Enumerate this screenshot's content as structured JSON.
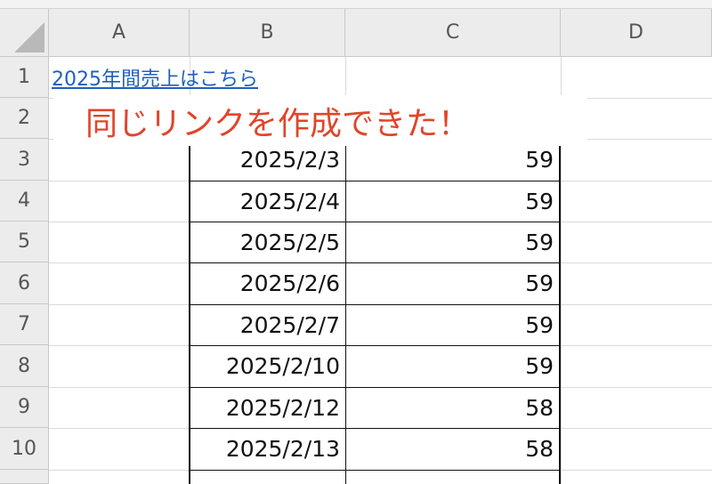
{
  "columns": [
    "A",
    "B",
    "C",
    "D"
  ],
  "row_numbers": [
    "1",
    "2",
    "3",
    "4",
    "5",
    "6",
    "7",
    "8",
    "9",
    "10"
  ],
  "a1_link": "2025年間売上はこちら",
  "banner_text": "同じリンクを作成できた！",
  "rows": [
    {
      "date": "2025/2/3",
      "value": "59"
    },
    {
      "date": "2025/2/4",
      "value": "59"
    },
    {
      "date": "2025/2/5",
      "value": "59"
    },
    {
      "date": "2025/2/6",
      "value": "59"
    },
    {
      "date": "2025/2/7",
      "value": "59"
    },
    {
      "date": "2025/2/10",
      "value": "59"
    },
    {
      "date": "2025/2/12",
      "value": "58"
    },
    {
      "date": "2025/2/13",
      "value": "58"
    }
  ],
  "colors": {
    "link": "#1f5fbf",
    "banner_text": "#e0452b",
    "header_bg": "#ececec"
  }
}
